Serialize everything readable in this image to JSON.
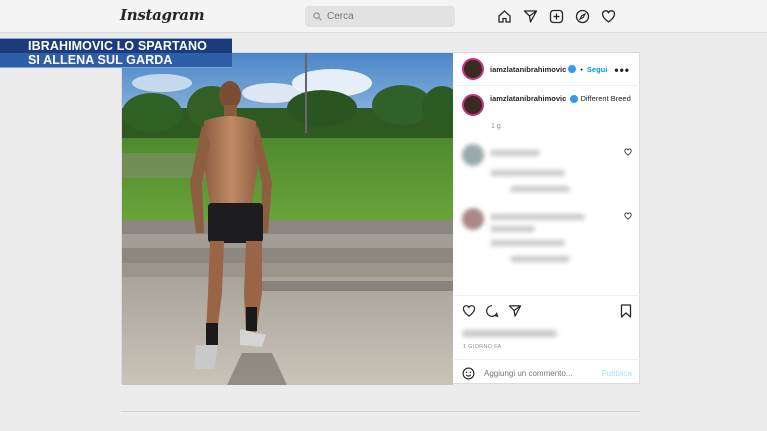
{
  "nav": {
    "logo": "Instagram",
    "search_placeholder": "Cerca",
    "icons": [
      "home-icon",
      "explore-send-icon",
      "new-post-icon",
      "compass-icon",
      "heart-icon"
    ]
  },
  "headline": {
    "line1": "IBRAHIMOVIC LO SPARTANO",
    "line2": "SI ALLENA SUL GARDA"
  },
  "post": {
    "username": "iamzlatanibrahimovic",
    "separator": "•",
    "follow_label": "Segui",
    "more_label": "•••",
    "caption_user": "iamzlatanibrahimovic",
    "caption_text": "Different Breed",
    "caption_time": "1 g",
    "time_ago": "1 GIORNO FA",
    "comment_placeholder": "Aggiungi un commento...",
    "publish_label": "Pubblica"
  },
  "colors": {
    "headline_dark": "#1b3b7a",
    "headline_light": "#2e5ea8",
    "link_blue": "#0095f6",
    "verified_blue": "#3897f0"
  }
}
